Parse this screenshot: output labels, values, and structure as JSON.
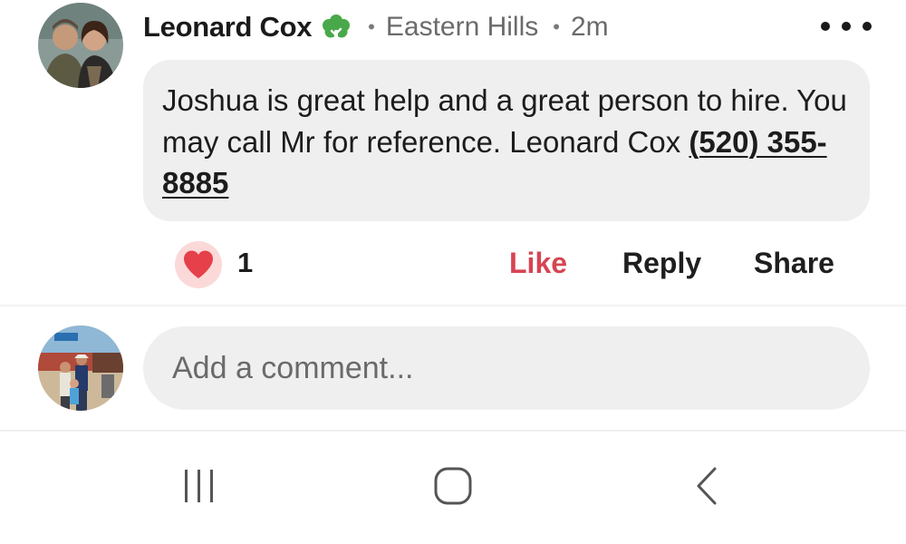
{
  "comment": {
    "author": {
      "name": "Leonard Cox",
      "badge_icon": "tree-badge-icon",
      "badge_color": "#49a84a",
      "location": "Eastern Hills",
      "time": "2m"
    },
    "body_text": "Joshua is great help and a great person to hire. You may call Mr for reference.  Leonard Cox ",
    "phone": "(520) 355-8885",
    "reaction": {
      "icon": "heart-icon",
      "color": "#e6404a",
      "count": "1"
    },
    "actions": {
      "like_label": "Like",
      "reply_label": "Reply",
      "share_label": "Share"
    },
    "more_icon": "more-options-icon"
  },
  "composer": {
    "placeholder": "Add a comment..."
  },
  "navbar": {
    "recent_icon": "recent-apps-icon",
    "home_icon": "home-icon",
    "back_icon": "back-icon"
  },
  "colors": {
    "bubble_bg": "#efefef",
    "like_active": "#d64552",
    "secondary_text": "#6b6b6b"
  }
}
